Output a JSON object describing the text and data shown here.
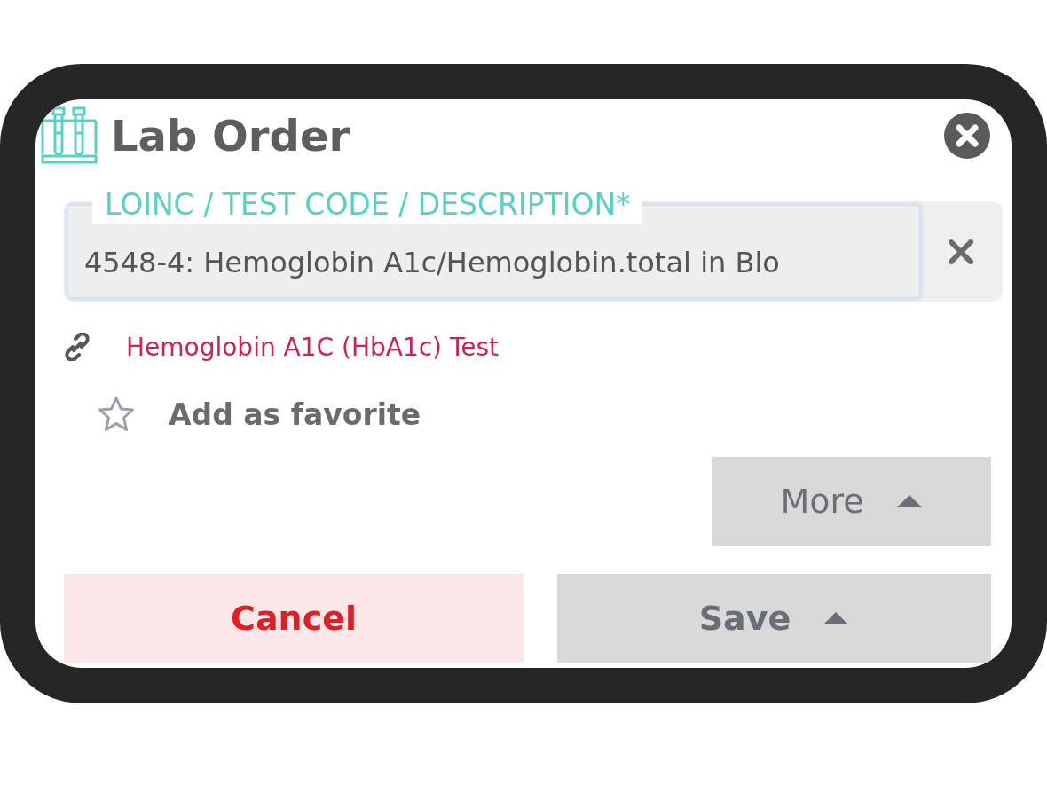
{
  "dialog": {
    "title": "Lab Order"
  },
  "test_field": {
    "label": "LOINC / TEST CODE / DESCRIPTION*",
    "value": "4548-4: Hemoglobin A1c/Hemoglobin.total in Blo"
  },
  "reference_link": {
    "text": "Hemoglobin A1C (HbA1c) Test"
  },
  "favorite": {
    "label": "Add as favorite",
    "checked": false
  },
  "more_button": {
    "label": "More"
  },
  "buttons": [
    {
      "label": "Cancel",
      "kind": "danger"
    },
    {
      "label": "Save",
      "kind": "menu"
    }
  ]
}
